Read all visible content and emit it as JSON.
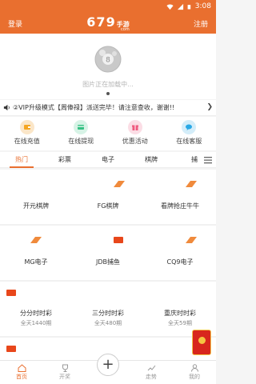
{
  "status_bar": {
    "time": "3:08"
  },
  "header": {
    "login_label": "登录",
    "register_label": "注册",
    "logo_number": "679",
    "logo_word": "手游",
    "logo_sub": "com"
  },
  "banner": {
    "loading_text": "图片正在加载中..."
  },
  "marquee": {
    "text": "②VIP升级模式【周俸禄】派送完毕！请注意查收，谢谢!!"
  },
  "quick_actions": [
    {
      "label": "在线充值",
      "icon": "wallet-icon",
      "color": "#f5a623"
    },
    {
      "label": "在线提现",
      "icon": "card-icon",
      "color": "#36c184"
    },
    {
      "label": "优惠活动",
      "icon": "gift-icon",
      "color": "#ef5a7f"
    },
    {
      "label": "在线客服",
      "icon": "chat-icon",
      "color": "#2aa9e6"
    }
  ],
  "tabs": [
    {
      "label": "热门",
      "active": true
    },
    {
      "label": "彩票"
    },
    {
      "label": "电子"
    },
    {
      "label": "棋牌"
    },
    {
      "label": "捕"
    }
  ],
  "games": [
    {
      "name": "开元棋牌",
      "sub": ""
    },
    {
      "name": "FG棋牌",
      "sub": ""
    },
    {
      "name": "看牌抢庄牛牛",
      "sub": ""
    },
    {
      "name": "MG电子",
      "sub": ""
    },
    {
      "name": "JDB捕鱼",
      "sub": ""
    },
    {
      "name": "CQ9电子",
      "sub": ""
    },
    {
      "name": "分分时时彩",
      "sub": "全天1440期"
    },
    {
      "name": "三分时时彩",
      "sub": "全天480期"
    },
    {
      "name": "重庆时时彩",
      "sub": "全天59期"
    },
    {
      "name": "",
      "sub": ""
    },
    {
      "name": "",
      "sub": ""
    },
    {
      "name": "",
      "sub": ""
    }
  ],
  "bottom_nav": [
    {
      "label": "首页",
      "icon": "home-icon",
      "active": true
    },
    {
      "label": "开奖",
      "icon": "trophy-icon"
    },
    {
      "label": "",
      "icon": "plus-icon"
    },
    {
      "label": "走势",
      "icon": "trend-icon"
    },
    {
      "label": "我的",
      "icon": "user-icon"
    }
  ],
  "colors": {
    "brand": "#e96f2f",
    "hot_tag": "#e8471b",
    "active_text": "#e96f2f"
  }
}
